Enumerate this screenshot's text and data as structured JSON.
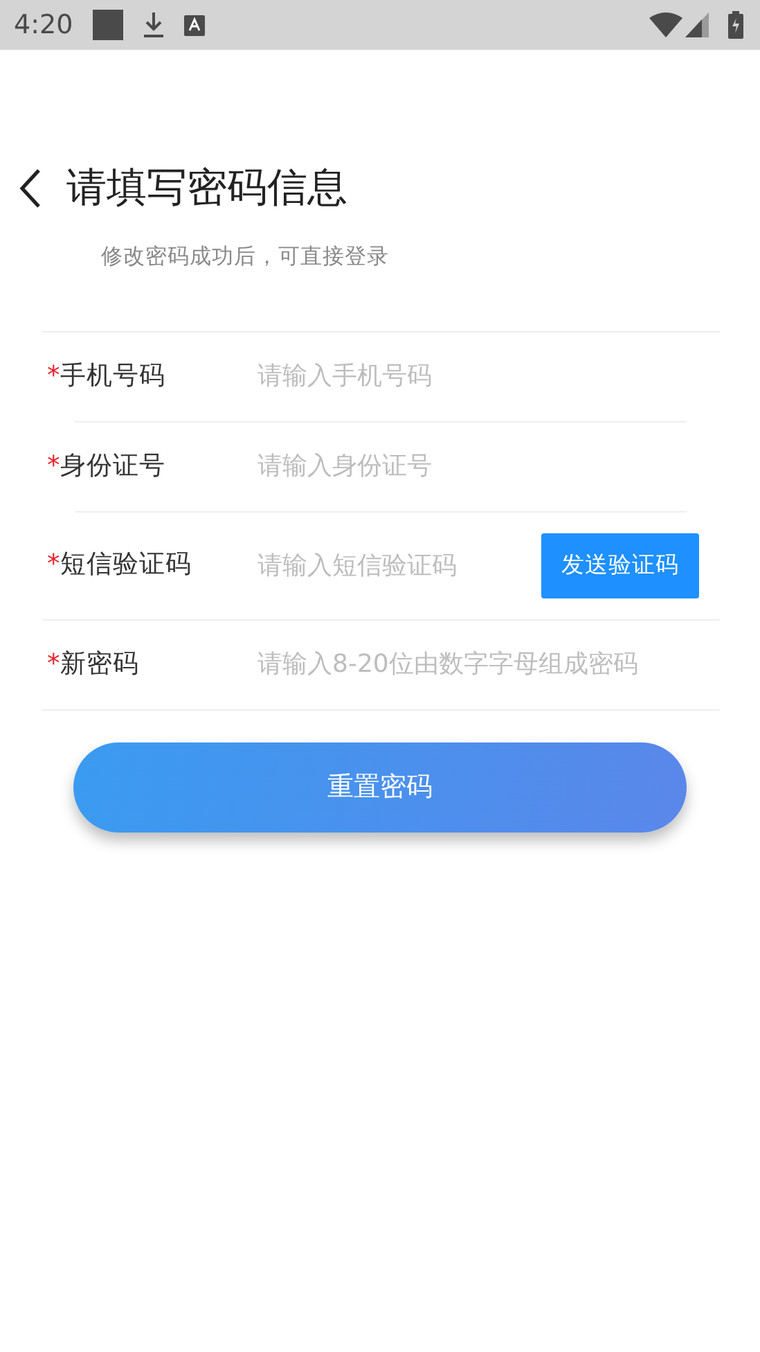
{
  "status_bar": {
    "time": "4:20"
  },
  "header": {
    "title": "请填写密码信息",
    "subtitle": "修改密码成功后，可直接登录"
  },
  "fields": [
    {
      "kind": "text",
      "marker": "*",
      "label": "手机号码",
      "placeholder": "请输入手机号码"
    },
    {
      "kind": "text",
      "marker": "*",
      "label": "身份证号",
      "placeholder": "请输入身份证号"
    },
    {
      "kind": "code",
      "marker": "*",
      "label": "短信验证码",
      "placeholder": "请输入短信验证码",
      "button": "发送验证码"
    },
    {
      "kind": "text",
      "marker": "*",
      "label": "新密码",
      "placeholder": "请输入8-20位由数字字母组成密码"
    }
  ],
  "submit": "重置密码"
}
